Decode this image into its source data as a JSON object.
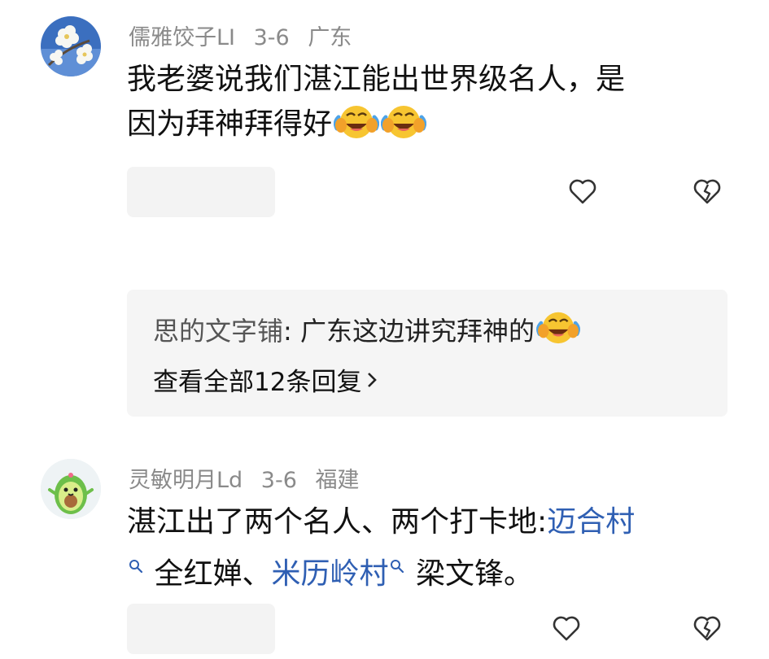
{
  "comments": [
    {
      "username": "儒雅饺子LI",
      "date": "3-6",
      "location": "广东",
      "text_line1": "我老婆说我们湛江能出世界级名人，是",
      "text_line2": "因为拜神拜得好",
      "emoji": "laughing-crying"
    },
    {
      "username": "灵敏明月Ld",
      "date": "3-6",
      "location": "福建",
      "text_line1_plain": "湛江出了两个名人、两个打卡地:",
      "link1": "迈合村",
      "text_line2_plain": "全红婵、",
      "link2": "米历岭村",
      "text_line2_end": "梁文锋。"
    }
  ],
  "reply_preview": {
    "author": "思的文字铺",
    "separator": ": ",
    "text": "广东这边讲究拜神的",
    "view_all": "查看全部12条回复"
  },
  "colors": {
    "link": "#2f5fb3",
    "meta": "#8a8a8a",
    "panel": "#f5f5f5"
  }
}
